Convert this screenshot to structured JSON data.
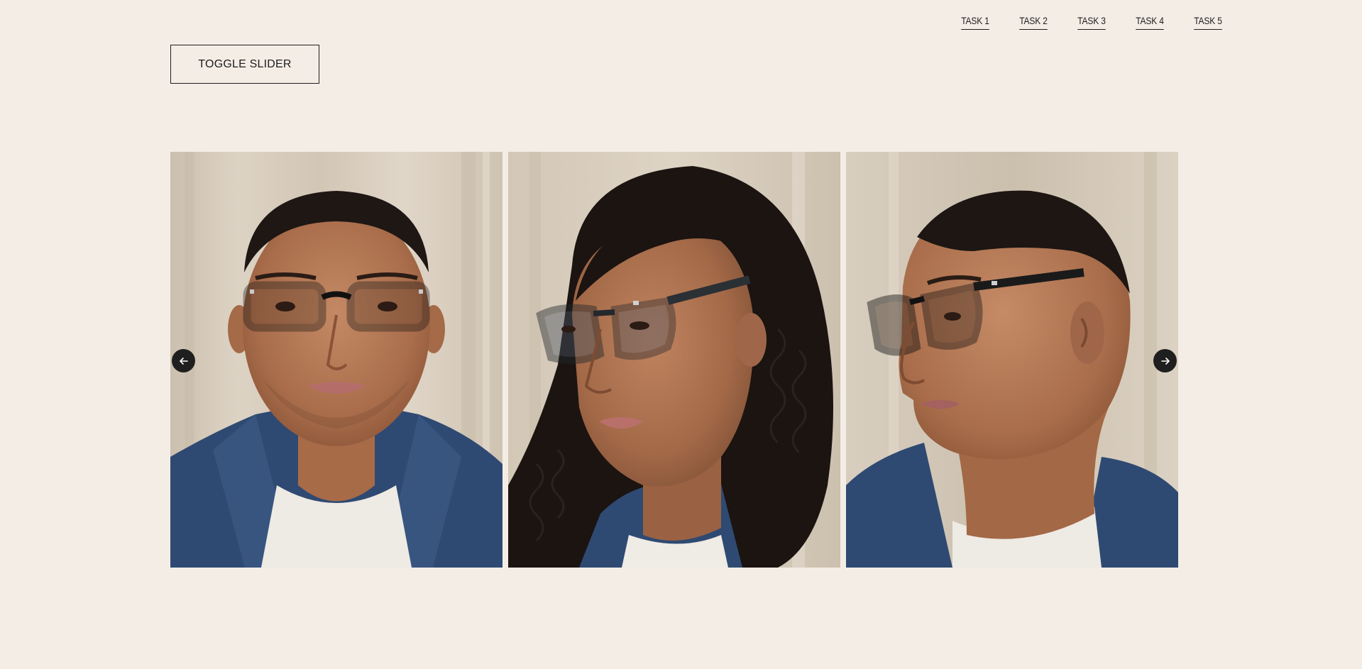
{
  "nav": {
    "tasks": [
      {
        "label": "TASK 1"
      },
      {
        "label": "TASK 2"
      },
      {
        "label": "TASK 3"
      },
      {
        "label": "TASK 4"
      },
      {
        "label": "TASK 5"
      }
    ]
  },
  "toolbar": {
    "toggle_label": "TOGGLE SLIDER"
  },
  "slider": {
    "prev_icon": "arrow-left-icon",
    "next_icon": "arrow-right-icon",
    "slides": [
      {
        "subject": "man-front-glasses"
      },
      {
        "subject": "woman-three-quarter-glasses"
      },
      {
        "subject": "man-profile-glasses"
      }
    ]
  },
  "colors": {
    "background": "#f4ede6",
    "text": "#1d1d1d",
    "arrow_bg": "#1f1f1f",
    "denim": "#2f4a72"
  }
}
